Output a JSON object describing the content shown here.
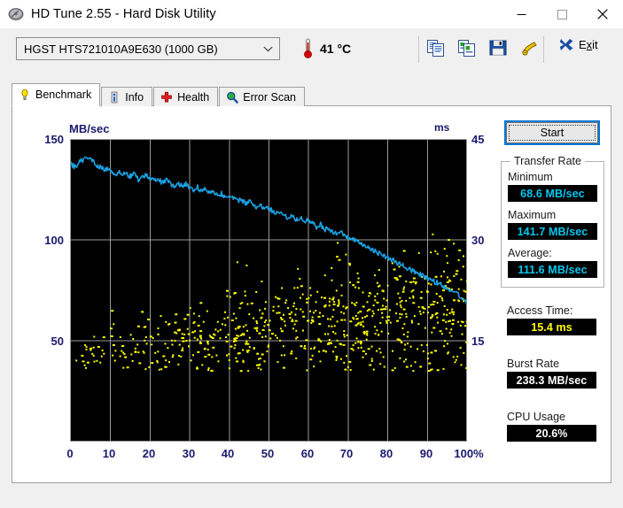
{
  "window": {
    "title": "HD Tune 2.55 - Hard Disk Utility",
    "icon": "hard-disk-icon",
    "minimize_label": "—",
    "maximize_label": "□",
    "close_label": "✕"
  },
  "toolbar": {
    "drive": "HGST   HTS721010A9E630 (1000 GB)",
    "temperature": "41 °C",
    "temperature_icon": "thermometer-icon",
    "icons": [
      {
        "name": "copy-icon",
        "label": "Copy"
      },
      {
        "name": "copy-image-icon",
        "label": "Copy with image"
      },
      {
        "name": "save-icon",
        "label": "Save"
      },
      {
        "name": "options-icon",
        "label": "Options"
      }
    ],
    "exit_label": "Exit",
    "exit_accel": "x",
    "exit_icon": "close-x-icon"
  },
  "tabs": [
    {
      "label": "Benchmark",
      "icon": "lightbulb-icon",
      "active": true
    },
    {
      "label": "Info",
      "icon": "info-icon",
      "active": false
    },
    {
      "label": "Health",
      "icon": "health-cross-icon",
      "active": false
    },
    {
      "label": "Error Scan",
      "icon": "magnifier-icon",
      "active": false
    }
  ],
  "side_panel": {
    "start_label": "Start",
    "transfer_rate": {
      "group_title": "Transfer Rate",
      "minimum_label": "Minimum",
      "minimum_value": "68.6 MB/sec",
      "maximum_label": "Maximum",
      "maximum_value": "141.7 MB/sec",
      "average_label": "Average:",
      "average_value": "111.6 MB/sec"
    },
    "access_time_label": "Access Time:",
    "access_time_value": "15.4 ms",
    "burst_rate_label": "Burst Rate",
    "burst_rate_value": "238.3 MB/sec",
    "cpu_usage_label": "CPU Usage",
    "cpu_usage_value": "20.6%"
  },
  "colors": {
    "transfer_line": "#1ba1e2",
    "access_points": "#ffff00",
    "plot_background": "#000000",
    "grid": "#9a9a9a",
    "axis_text": "#1a1a6e",
    "accent": "#0078d7"
  },
  "chart_data": {
    "type": "line",
    "title": "",
    "xlabel": "",
    "ylabel": "MB/sec",
    "y2label": "ms",
    "xlim": [
      0,
      100
    ],
    "ylim": [
      0,
      150
    ],
    "y2lim": [
      0,
      45
    ],
    "grid": true,
    "xticks": [
      0,
      10,
      20,
      30,
      40,
      50,
      60,
      70,
      80,
      90,
      100
    ],
    "xtick_labels": [
      "0",
      "10",
      "20",
      "30",
      "40",
      "50",
      "60",
      "70",
      "80",
      "90",
      "100%"
    ],
    "yticks": [
      50,
      100,
      150
    ],
    "ytick_labels": [
      "50",
      "100",
      "150"
    ],
    "y2ticks": [
      15,
      30,
      45
    ],
    "y2tick_labels": [
      "15",
      "30",
      "45"
    ],
    "series": [
      {
        "name": "Transfer rate",
        "axis": "left",
        "color": "#1ba1e2",
        "x": [
          0,
          1,
          2,
          3,
          4,
          5,
          6,
          7,
          8,
          9,
          10,
          11,
          12,
          13,
          14,
          15,
          16,
          17,
          18,
          19,
          20,
          21,
          22,
          23,
          24,
          25,
          26,
          27,
          28,
          29,
          30,
          31,
          32,
          33,
          34,
          35,
          36,
          37,
          38,
          39,
          40,
          41,
          42,
          43,
          44,
          45,
          46,
          47,
          48,
          49,
          50,
          51,
          52,
          53,
          54,
          55,
          56,
          57,
          58,
          59,
          60,
          61,
          62,
          63,
          64,
          65,
          66,
          67,
          68,
          69,
          70,
          71,
          72,
          73,
          74,
          75,
          76,
          77,
          78,
          79,
          80,
          81,
          82,
          83,
          84,
          85,
          86,
          87,
          88,
          89,
          90,
          91,
          92,
          93,
          94,
          95,
          96,
          97,
          98,
          99,
          100
        ],
        "y": [
          137.5,
          136.0,
          138.5,
          139.5,
          141.7,
          140.0,
          138.0,
          136.5,
          135.0,
          135.5,
          134.0,
          132.5,
          133.5,
          132.0,
          133.0,
          131.5,
          132.5,
          130.0,
          131.0,
          132.0,
          130.5,
          129.0,
          130.0,
          128.5,
          129.5,
          128.0,
          127.0,
          128.0,
          126.5,
          127.5,
          126.0,
          125.0,
          126.0,
          124.0,
          125.0,
          123.5,
          124.5,
          122.0,
          123.0,
          121.0,
          122.0,
          120.5,
          119.0,
          120.0,
          118.0,
          119.0,
          117.5,
          116.0,
          117.0,
          115.0,
          116.0,
          114.0,
          113.0,
          114.0,
          112.0,
          111.0,
          112.0,
          110.0,
          111.0,
          109.5,
          110.5,
          108.0,
          106.5,
          107.5,
          105.0,
          106.0,
          104.0,
          103.0,
          104.0,
          102.0,
          101.0,
          100.5,
          99.0,
          98.0,
          97.0,
          96.0,
          95.0,
          94.5,
          93.0,
          92.0,
          91.0,
          90.0,
          89.0,
          88.0,
          87.0,
          86.0,
          85.0,
          84.0,
          83.0,
          82.0,
          81.0,
          80.0,
          79.0,
          78.5,
          77.0,
          76.0,
          75.0,
          74.0,
          72.5,
          71.0,
          68.6
        ]
      },
      {
        "name": "Access time",
        "axis": "right",
        "color": "#ffff00",
        "type": "scatter",
        "description": "Yellow scattered access-time samples, mostly 12-28 ms, denser and lower at the start of the disk, rising and spreading toward the end.",
        "average_ms": 15.4
      }
    ]
  }
}
